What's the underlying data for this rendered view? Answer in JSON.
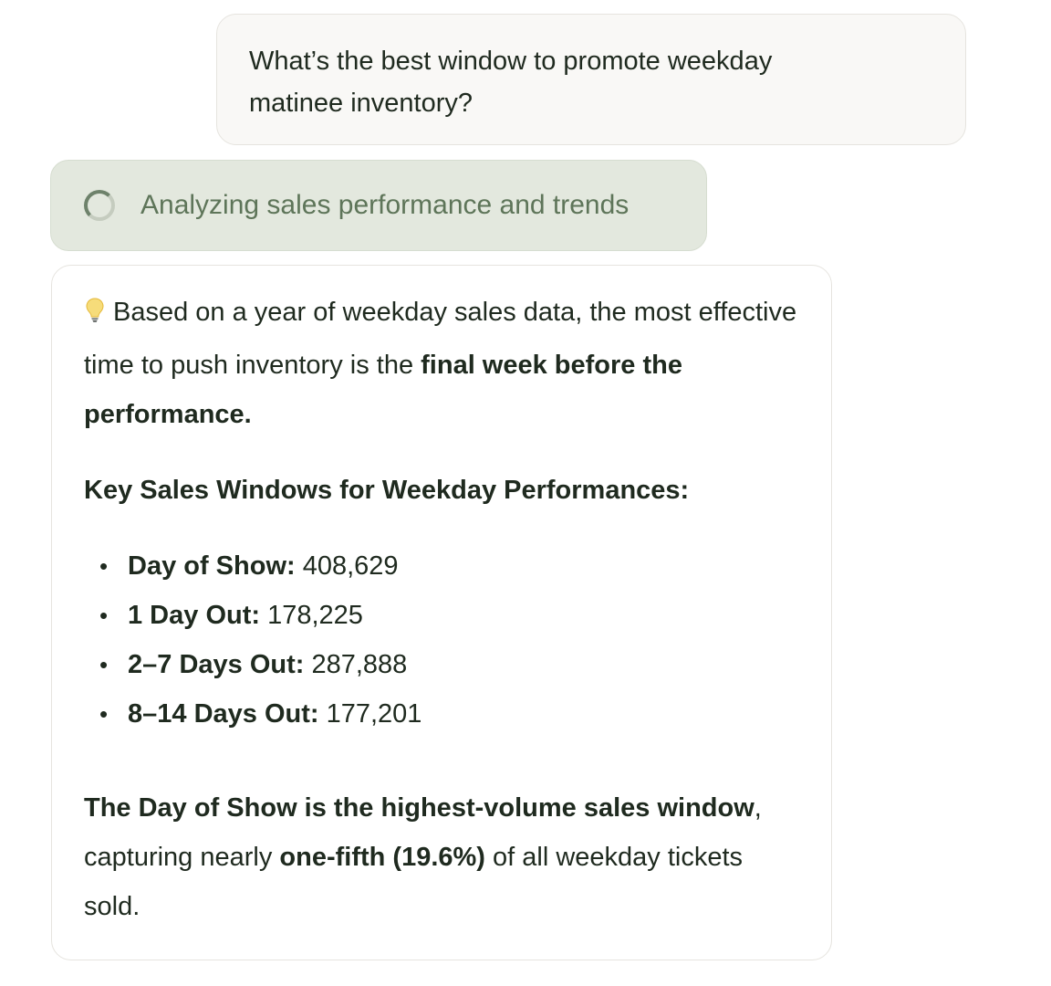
{
  "user_message": {
    "line_1": "What’s the best window to promote weekday",
    "line_2": "matinee inventory?"
  },
  "status": {
    "label": "Analyzing sales performance and trends",
    "icon": "spinner-icon"
  },
  "answer": {
    "intro_icon": "lightbulb-icon",
    "intro_text": "Based on a year of weekday sales data, the most effective time to push inventory is the",
    "intro_bold": "final week before the performance.",
    "heading": "Key Sales Windows for Weekday Performances:",
    "stats": [
      {
        "label": "Day of Show:",
        "value": "408,629"
      },
      {
        "label": "1 Day Out:",
        "value": "178,225"
      },
      {
        "label": "2–7 Days Out:",
        "value": "287,888"
      },
      {
        "label": "8–14 Days Out:",
        "value": "177,201"
      }
    ],
    "summary_bold_1": "The Day of Show is the highest-volume sales window",
    "summary_text_1": ", capturing nearly",
    "summary_bold_2": "one-fifth (19.6%)",
    "summary_text_2": "of all weekday tickets sold."
  },
  "colors": {
    "status_background": "#e3e8de",
    "status_text": "#5e7559",
    "user_bubble_background": "#f9f8f6",
    "text": "#1f2a1f"
  }
}
